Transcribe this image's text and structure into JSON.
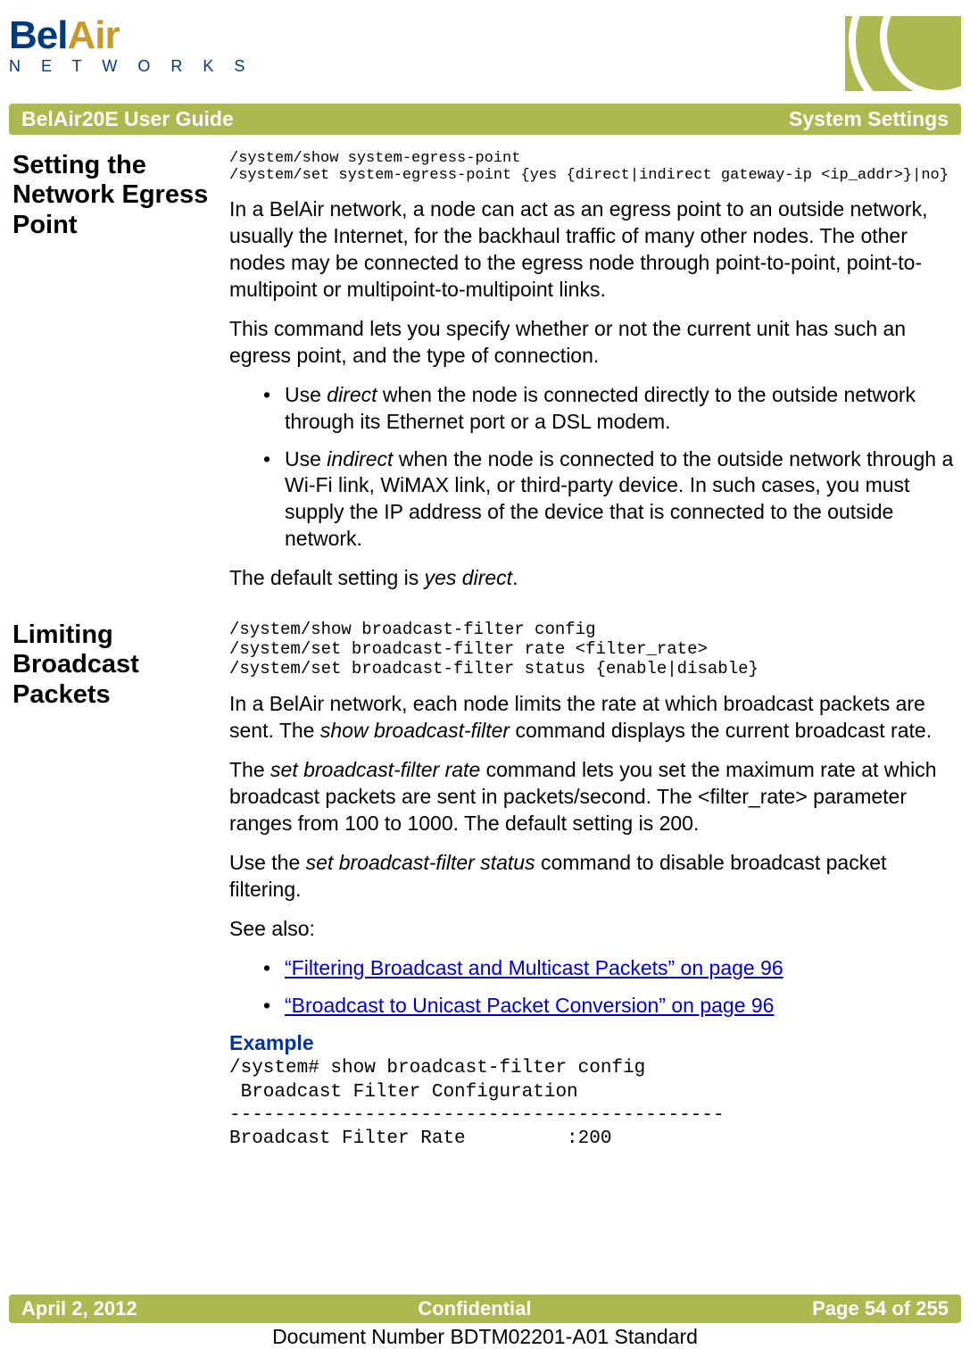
{
  "logo": {
    "bel": "Bel",
    "air": "Air",
    "networks": "N E T W O R K S"
  },
  "topbar": {
    "left": "BelAir20E User Guide",
    "right": "System Settings"
  },
  "s1": {
    "heading": "Setting the Network Egress Point",
    "code": "/system/show system-egress-point\n/system/set system-egress-point {yes {direct|indirect gateway-ip <ip_addr>}|no}",
    "p1": "In a BelAir network, a node can act as an egress point to an outside network, usually the Internet, for the backhaul traffic of many other nodes. The other nodes may be connected to the egress node through point-to-point, point-to-multipoint or multipoint-to-multipoint links.",
    "p2": "This command lets you specify whether or not the current unit has such an egress point, and the type of connection.",
    "b1a": "Use ",
    "b1i": "direct",
    "b1b": " when the node is connected directly to the outside network through its Ethernet port or a DSL modem.",
    "b2a": "Use ",
    "b2i": "indirect",
    "b2b": " when the node is connected to the outside network through a Wi-Fi link, WiMAX link, or third-party device. In such cases, you must supply the IP address of the device that is connected to the outside network.",
    "p3a": "The default setting is ",
    "p3i": "yes direct",
    "p3b": "."
  },
  "s2": {
    "heading": "Limiting Broadcast Packets",
    "code": "/system/show broadcast-filter config\n/system/set broadcast-filter rate <filter_rate>\n/system/set broadcast-filter status {enable|disable}",
    "p1a": "In a BelAir network, each node limits the rate at which broadcast packets are sent. The ",
    "p1i": "show broadcast-filter",
    "p1b": " command displays the current broadcast rate.",
    "p2a": "The ",
    "p2i": "set broadcast-filter rate",
    "p2b": " command lets you set the maximum rate at which broadcast packets are sent in packets/second. The <filter_rate> parameter ranges from 100 to 1000. The default setting is 200.",
    "p3a": "Use the ",
    "p3i": "set broadcast-filter status",
    "p3b": " command to disable broadcast packet filtering.",
    "p4": "See also:",
    "link1": "“Filtering Broadcast and Multicast Packets” on page 96",
    "link2": "“Broadcast to Unicast Packet Conversion” on page 96",
    "example_h": "Example",
    "example_code": "/system# show broadcast-filter config\n Broadcast Filter Configuration\n--------------------------------------------\nBroadcast Filter Rate         :200"
  },
  "footer": {
    "date": "April 2, 2012",
    "conf": "Confidential",
    "page": "Page 54 of 255",
    "docnum": "Document Number BDTM02201-A01 Standard"
  }
}
